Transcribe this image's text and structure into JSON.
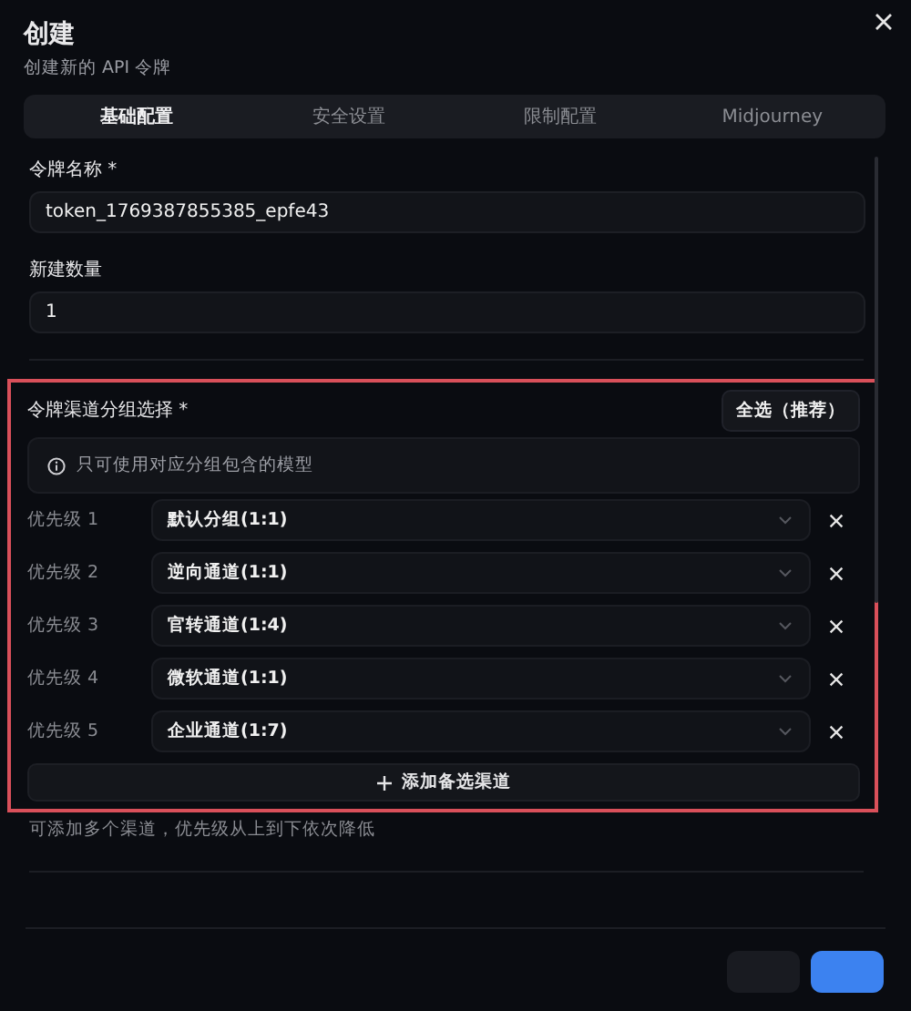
{
  "dialog": {
    "title": "创建",
    "subtitle": "创建新的 API 令牌"
  },
  "tabs": [
    {
      "label": "基础配置",
      "selected": true
    },
    {
      "label": "安全设置",
      "selected": false
    },
    {
      "label": "限制配置",
      "selected": false
    },
    {
      "label": "Midjourney",
      "selected": false
    }
  ],
  "fields": [
    {
      "label": "令牌名称 *",
      "value": "token_1769387855385_epfe43"
    },
    {
      "label": "新建数量",
      "value": "1"
    }
  ],
  "channel_groups": {
    "label": "令牌渠道分组选择 *",
    "select_all": "全选（推荐）",
    "info": "只可使用对应分组包含的模型",
    "rows": [
      {
        "priority": "优先级 1",
        "group": "默认分组(1:1)"
      },
      {
        "priority": "优先级 2",
        "group": "逆向通道(1:1)"
      },
      {
        "priority": "优先级 3",
        "group": "官转通道(1:4)"
      },
      {
        "priority": "优先级 4",
        "group": "微软通道(1:1)"
      },
      {
        "priority": "优先级 5",
        "group": "企业通道(1:7)"
      }
    ],
    "add_button": "添加备选渠道",
    "hint": "可添加多个渠道，优先级从上到下依次降低"
  },
  "footer": {
    "buttons": [
      {
        "kind": "secondary"
      },
      {
        "kind": "primary"
      }
    ]
  }
}
